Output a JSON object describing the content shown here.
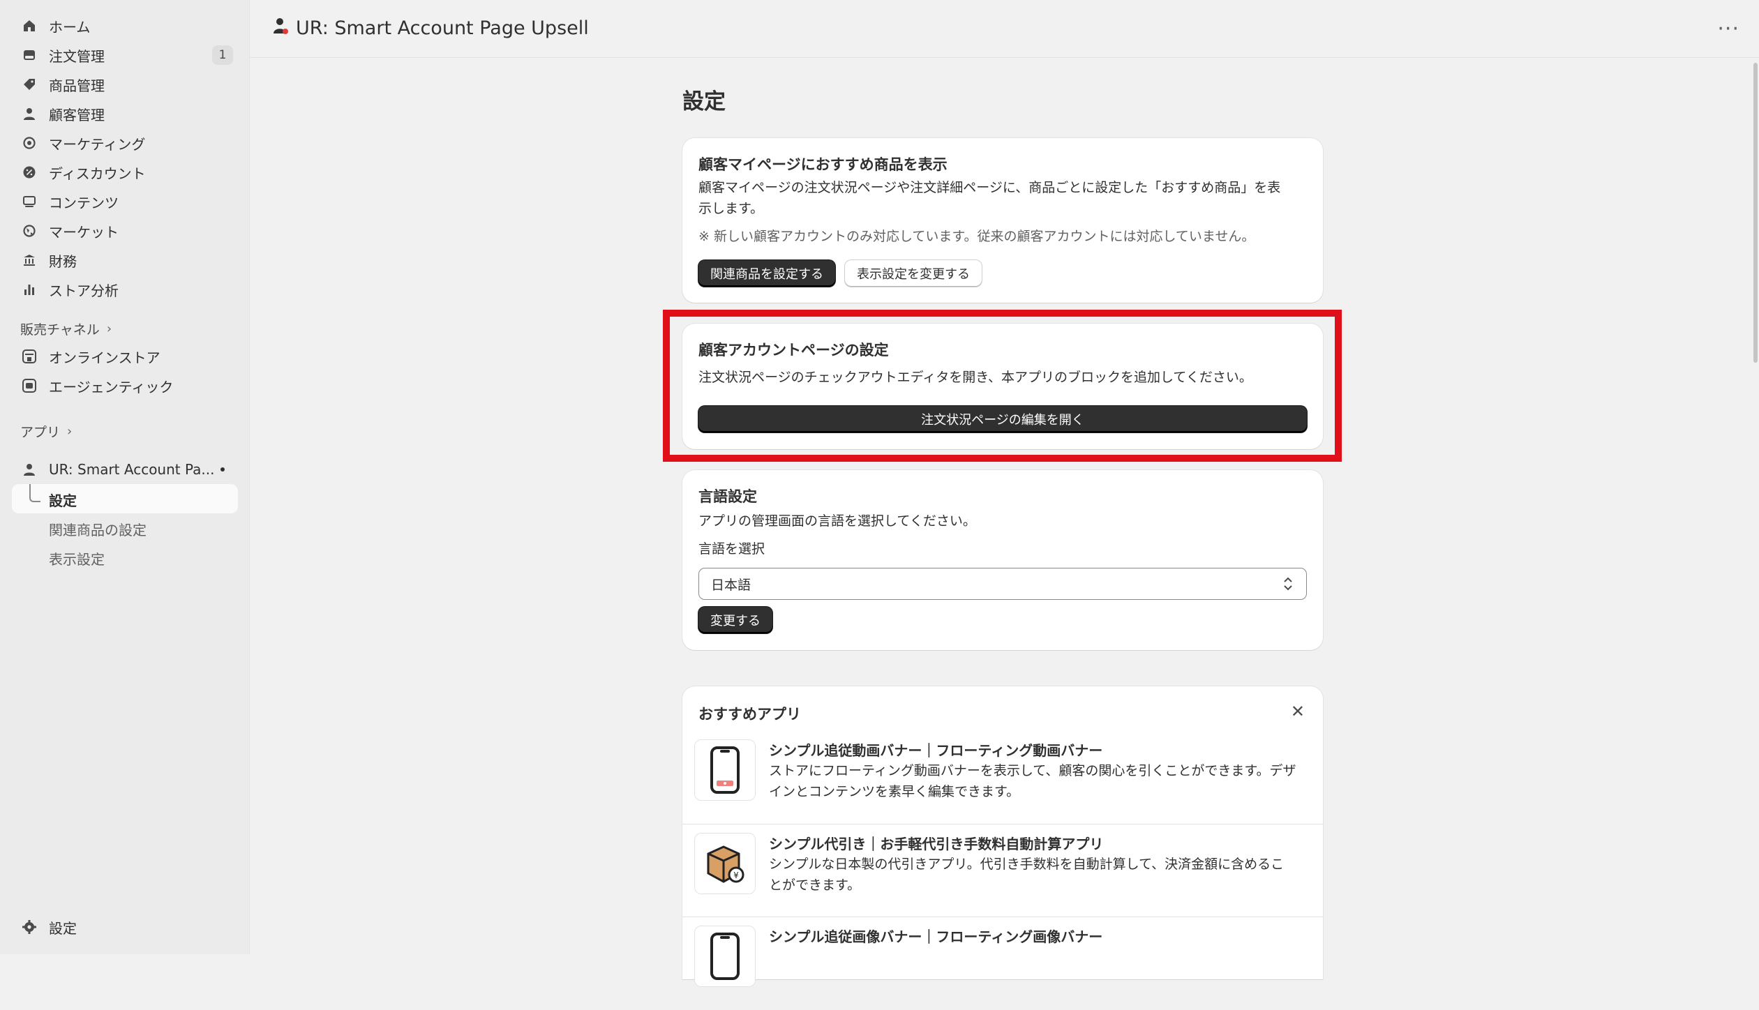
{
  "sidebar": {
    "items": [
      {
        "label": "ホーム",
        "icon": "home-icon"
      },
      {
        "label": "注文管理",
        "icon": "orders-icon",
        "count": "1"
      },
      {
        "label": "商品管理",
        "icon": "tag-icon"
      },
      {
        "label": "顧客管理",
        "icon": "person-icon"
      },
      {
        "label": "マーケティング",
        "icon": "target-icon"
      },
      {
        "label": "ディスカウント",
        "icon": "discount-icon"
      },
      {
        "label": "コンテンツ",
        "icon": "content-icon"
      },
      {
        "label": "マーケット",
        "icon": "globe-icon"
      },
      {
        "label": "財務",
        "icon": "bank-icon"
      },
      {
        "label": "ストア分析",
        "icon": "chart-bar-icon"
      }
    ],
    "sales_channels_label": "販売チャネル",
    "channels": [
      {
        "label": "オンラインストア",
        "icon": "store-icon"
      },
      {
        "label": "エージェンティック",
        "icon": "agentic-icon"
      }
    ],
    "apps_label": "アプリ",
    "app": {
      "label": "UR: Smart Account Pa...",
      "icon": "app-person-icon"
    },
    "app_subitems": [
      {
        "label": "設定"
      },
      {
        "label": "関連商品の設定"
      },
      {
        "label": "表示設定"
      }
    ],
    "settings_label": "設定"
  },
  "header": {
    "title": "UR: Smart Account Page Upsell",
    "more": "···"
  },
  "main": {
    "page_title": "設定",
    "card1": {
      "title": "顧客マイページにおすすめ商品を表示",
      "desc_line1": "顧客マイページの注文状況ページや注文詳細ページに、商品ごとに設定した「おすすめ商品」を表",
      "desc_line2": "示します。",
      "note": "※ 新しい顧客アカウントのみ対応しています。従来の顧客アカウントには対応していません。",
      "primary_button": "関連商品を設定する",
      "secondary_button": "表示設定を変更する"
    },
    "card2": {
      "title": "顧客アカウントページの設定",
      "desc": "注文状況ページのチェックアウトエディタを開き、本アプリのブロックを追加してください。",
      "button": "注文状況ページの編集を開く"
    },
    "card3": {
      "title": "言語設定",
      "desc": "アプリの管理画面の言語を選択してください。",
      "select_label": "言語を選択",
      "select_value": "日本語",
      "button": "変更する"
    },
    "card4": {
      "title": "おすすめアプリ",
      "items": [
        {
          "title": "シンプル追従動画バナー｜フローティング動画バナー",
          "desc_line1": "ストアにフローティング動画バナーを表示して、顧客の関心を引くことができます。デザ",
          "desc_line2": "インとコンテンツを素早く編集できます。",
          "icon": "phone-video-icon"
        },
        {
          "title": "シンプル代引き｜お手軽代引き手数料自動計算アプリ",
          "desc_line1": "シンプルな日本製の代引きアプリ。代引き手数料を自動計算して、決済金額に含めるこ",
          "desc_line2": "とができます。",
          "icon": "box-yen-icon"
        },
        {
          "title": "シンプル追従画像バナー｜フローティング画像バナー",
          "icon": "phone-image-icon"
        }
      ]
    }
  },
  "colors": {
    "highlight": "#e00f19",
    "primary_button": "#303030",
    "background": "#f1f1f1",
    "sidebar": "#ebebeb"
  }
}
